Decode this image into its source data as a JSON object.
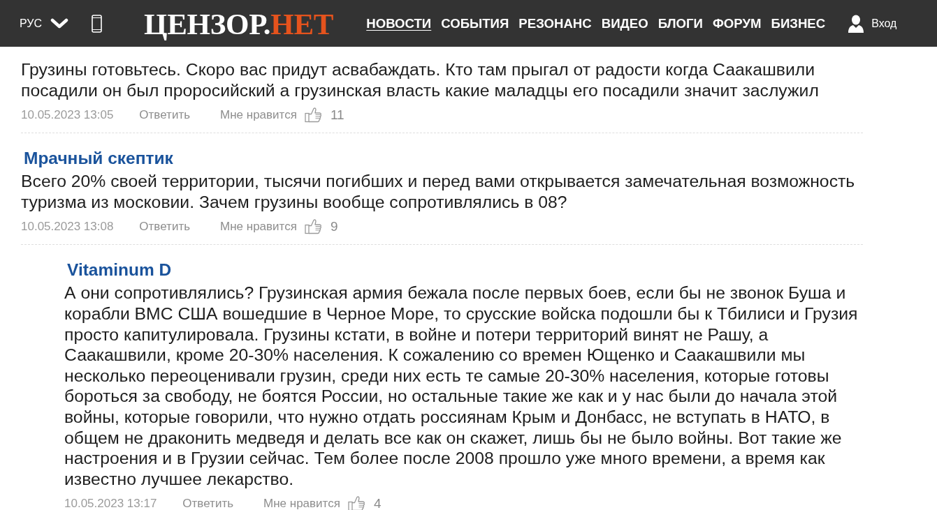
{
  "header": {
    "language": "РУС",
    "logo": {
      "main": "ЦЕНЗОР.",
      "accent": "НЕТ"
    },
    "nav": [
      {
        "label": "НОВОСТИ",
        "selected": true
      },
      {
        "label": "СОБЫТИЯ",
        "selected": false
      },
      {
        "label": "РЕЗОНАНС",
        "selected": false
      },
      {
        "label": "ВИДЕО",
        "selected": false
      },
      {
        "label": "БЛОГИ",
        "selected": false
      },
      {
        "label": "ФОРУМ",
        "selected": false
      },
      {
        "label": "БИЗНЕС",
        "selected": false
      }
    ],
    "login": "Вход"
  },
  "comments": [
    {
      "text": "Грузины готовьтесь. Скоро вас придут асвабаждать. Кто там прыгал от радости когда Саакашвили посадили он был проросийский а грузинская власть какие маладцы его посадили значит заслужил",
      "date": "10.05.2023 13:05",
      "reply": "Ответить",
      "like": "Мне нравится",
      "likes": "11"
    },
    {
      "author": "Мрачный скептик",
      "text": "Всего 20% своей территории, тысячи погибших и перед вами открывается замечательная возможность туризма из московии. Зачем грузины вообще сопротивлялись в 08?",
      "date": "10.05.2023 13:08",
      "reply": "Ответить",
      "like": "Мне нравится",
      "likes": "9",
      "children": [
        {
          "author": "Vitaminum D",
          "text": "А они сопротивлялись? Грузинская армия бежала после первых боев, если бы не звонок Буша и корабли ВМС США вошедшие в Черное Море, то срусские войска подошли бы к Тбилиси и Грузия просто капитулировала. Грузины кстати, в войне и потери территорий винят не Рашу, а Саакашвили, кроме 20-30% населения. К сожалению со времен Ющенко и Саакашвили мы несколько переоценивали грузин, среди них есть те самые 20-30% населения, которые готовы бороться за свободу, не боятся России, но остальные такие же как и у нас были до начала этой войны, которые говорили, что нужно отдать россиянам Крым и Донбасс, не вступать в НАТО, в общем не драконить медведя и делать все как он скажет, лишь бы не было войны. Вот такие же настроения и в Грузии сейчас. Тем более после 2008 прошло уже много времени, а время как известно лучшее лекарство.",
          "date": "10.05.2023 13:17",
          "reply": "Ответить",
          "like": "Мне нравится",
          "likes": "4"
        }
      ]
    }
  ]
}
